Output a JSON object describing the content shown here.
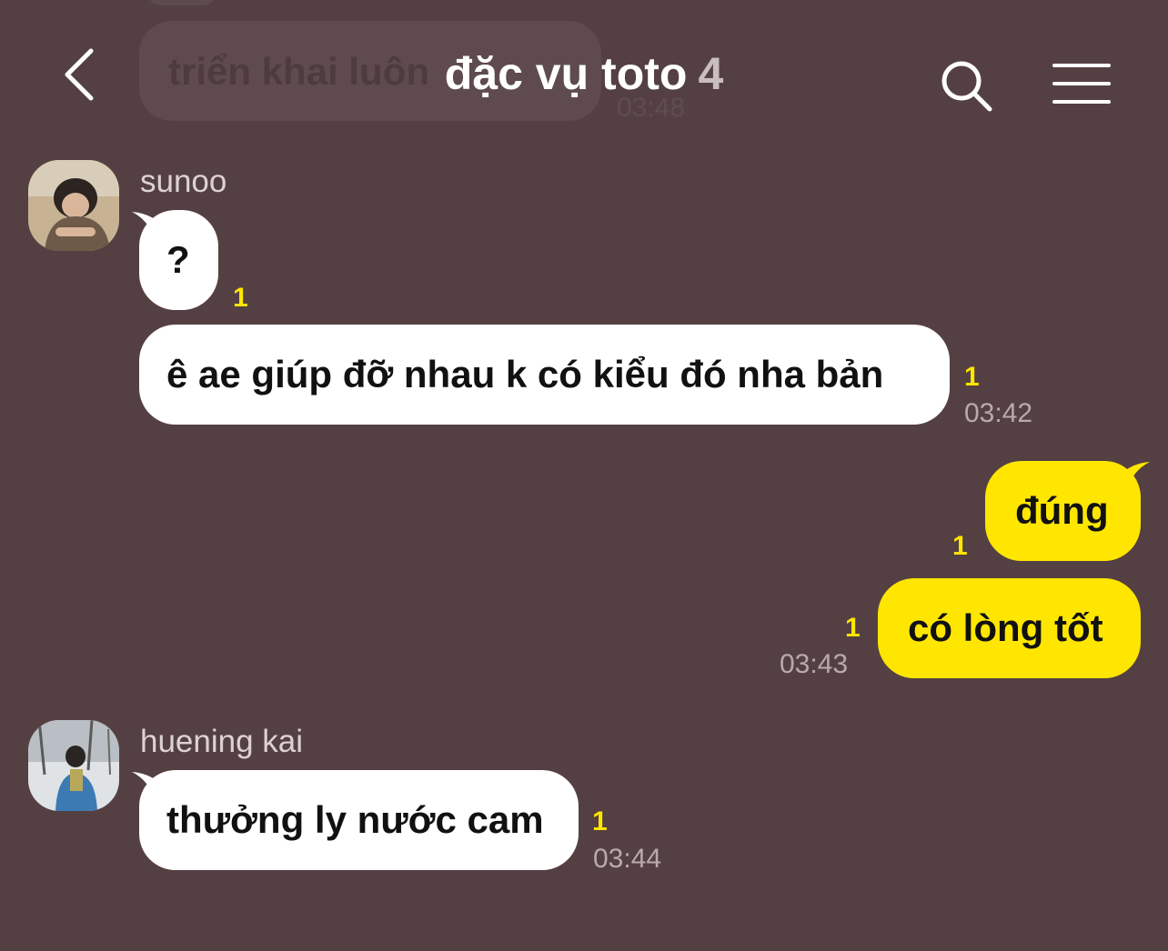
{
  "header": {
    "title": "đặc vụ toto",
    "member_count": "4"
  },
  "previous_message": {
    "text": "triển khai luôn",
    "time": "03:48"
  },
  "messages": [
    {
      "sender": "sunoo",
      "text": "?",
      "unread": "1",
      "time": ""
    },
    {
      "text": "ê ae giúp đỡ nhau k có kiểu đó nha bản",
      "unread": "1",
      "time": "03:42"
    },
    {
      "text": "đúng",
      "unread": "1",
      "time": ""
    },
    {
      "text": "có lòng tốt",
      "unread": "1",
      "time": "03:43"
    },
    {
      "sender": "huening kai",
      "text": "thưởng ly nước cam",
      "unread": "1",
      "time": "03:44"
    }
  ],
  "colors": {
    "background": "#544042",
    "incoming_bubble": "#ffffff",
    "outgoing_bubble": "#ffe600",
    "unread": "#ffe600"
  },
  "icons": [
    "back-arrow-icon",
    "search-icon",
    "menu-icon"
  ]
}
